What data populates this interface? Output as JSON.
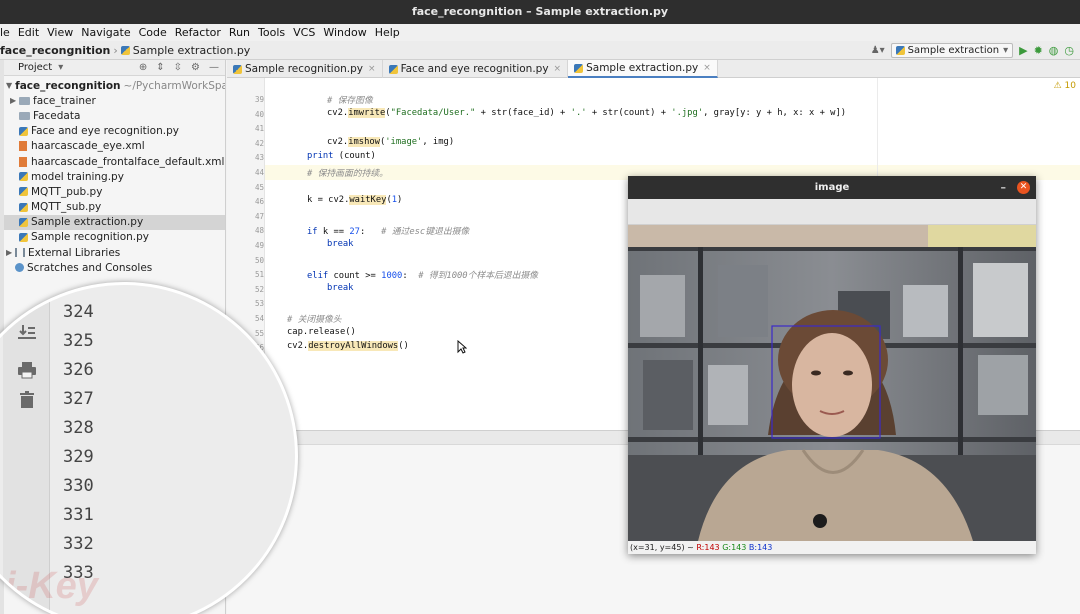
{
  "window": {
    "title": "face_recongnition – Sample extraction.py"
  },
  "menu": [
    "le",
    "Edit",
    "View",
    "Navigate",
    "Code",
    "Refactor",
    "Run",
    "Tools",
    "VCS",
    "Window",
    "Help"
  ],
  "nav": {
    "project": "face_recongnition",
    "file": "Sample extraction.py",
    "run_config": "Sample extraction"
  },
  "project_panel": {
    "title": "Project",
    "root": {
      "name": "face_recongnition",
      "path": "~/PycharmWorkSpace/"
    },
    "items": [
      {
        "label": "face_trainer",
        "type": "folder"
      },
      {
        "label": "Facedata",
        "type": "folder"
      },
      {
        "label": "Face and eye recognition.py",
        "type": "py"
      },
      {
        "label": "haarcascade_eye.xml",
        "type": "xml"
      },
      {
        "label": "haarcascade_frontalface_default.xml",
        "type": "xml"
      },
      {
        "label": "model training.py",
        "type": "py"
      },
      {
        "label": "MQTT_pub.py",
        "type": "py"
      },
      {
        "label": "MQTT_sub.py",
        "type": "py"
      },
      {
        "label": "Sample extraction.py",
        "type": "py",
        "selected": true
      },
      {
        "label": "Sample recognition.py",
        "type": "py"
      }
    ],
    "external": "External Libraries",
    "scratches": "Scratches and Consoles"
  },
  "tabs": [
    {
      "label": "Sample recognition.py",
      "active": false
    },
    {
      "label": "Face and eye recognition.py",
      "active": false
    },
    {
      "label": "Sample extraction.py",
      "active": true
    }
  ],
  "editor": {
    "warning": "⚠ 10",
    "line_numbers": [
      "39",
      "40",
      "41",
      "42",
      "43",
      "44",
      "45",
      "46",
      "47",
      "48",
      "49",
      "50",
      "51",
      "52",
      "53",
      "54",
      "55"
    ],
    "lines": [
      {
        "n": "39",
        "indent": 2,
        "parts": [
          {
            "t": "# 保存图像",
            "c": "cmt"
          }
        ]
      },
      {
        "n": "40",
        "indent": 2,
        "parts": [
          {
            "t": "cv2."
          },
          {
            "t": "imwrite",
            "c": "hl"
          },
          {
            "t": "("
          },
          {
            "t": "\"Facedata/User.\"",
            "c": "str"
          },
          {
            "t": " + str(face_id) + "
          },
          {
            "t": "'.'",
            "c": "str"
          },
          {
            "t": " + str(count) + "
          },
          {
            "t": "'.jpg'",
            "c": "str"
          },
          {
            "t": ", gray[y: y + h, x: x + w])"
          }
        ]
      },
      {
        "n": "41",
        "indent": 0,
        "parts": []
      },
      {
        "n": "42",
        "indent": 2,
        "parts": [
          {
            "t": "cv2."
          },
          {
            "t": "imshow",
            "c": "hl"
          },
          {
            "t": "("
          },
          {
            "t": "'image'",
            "c": "str"
          },
          {
            "t": ", img)"
          }
        ]
      },
      {
        "n": "43",
        "indent": 1,
        "parts": [
          {
            "t": "print",
            "c": "kw"
          },
          {
            "t": " (count)"
          }
        ]
      },
      {
        "n": "44",
        "indent": 1,
        "parts": [
          {
            "t": "# 保持画面的持续。",
            "c": "cmt"
          }
        ],
        "current": true
      },
      {
        "n": "45",
        "indent": 0,
        "parts": []
      },
      {
        "n": "46",
        "indent": 1,
        "parts": [
          {
            "t": "k = cv2."
          },
          {
            "t": "waitKey",
            "c": "hl"
          },
          {
            "t": "("
          },
          {
            "t": "1",
            "c": "num"
          },
          {
            "t": ")"
          }
        ]
      },
      {
        "n": "47",
        "indent": 0,
        "parts": []
      },
      {
        "n": "48",
        "indent": 1,
        "parts": [
          {
            "t": "if",
            "c": "kw"
          },
          {
            "t": " k == "
          },
          {
            "t": "27",
            "c": "num"
          },
          {
            "t": ":   "
          },
          {
            "t": "# 通过esc键退出摄像",
            "c": "cmt"
          }
        ]
      },
      {
        "n": "49",
        "indent": 2,
        "parts": [
          {
            "t": "break",
            "c": "kw"
          }
        ]
      },
      {
        "n": "50",
        "indent": 0,
        "parts": []
      },
      {
        "n": "51",
        "indent": 1,
        "parts": [
          {
            "t": "elif",
            "c": "kw"
          },
          {
            "t": " count >= "
          },
          {
            "t": "1000",
            "c": "num"
          },
          {
            "t": ":  "
          },
          {
            "t": "# 得到1000个样本后退出摄像",
            "c": "cmt"
          }
        ]
      },
      {
        "n": "52",
        "indent": 2,
        "parts": [
          {
            "t": "break",
            "c": "kw"
          }
        ]
      },
      {
        "n": "53",
        "indent": 0,
        "parts": []
      },
      {
        "n": "54",
        "indent": 0,
        "parts": [
          {
            "t": "# 关闭摄像头",
            "c": "cmt"
          }
        ]
      },
      {
        "n": "55",
        "indent": 0,
        "parts": [
          {
            "t": "cap.release()"
          }
        ]
      },
      {
        "n": "56",
        "indent": 0,
        "parts": [
          {
            "t": "cv2."
          },
          {
            "t": "destroyAllWindows",
            "c": "hl"
          },
          {
            "t": "()"
          }
        ]
      }
    ]
  },
  "magnifier": {
    "numbers": [
      "324",
      "325",
      "326",
      "327",
      "328",
      "329",
      "330",
      "331",
      "332",
      "333"
    ],
    "icons": [
      "scroll-to-end-icon",
      "print-icon",
      "trash-icon"
    ],
    "watermark": "i-Key"
  },
  "cv_window": {
    "title": "image",
    "status": {
      "coords": "(x=31, y=45) ~",
      "r": "R:143",
      "g": "G:143",
      "b": "B:143"
    }
  },
  "colors": {
    "accent": "#4a7fc1",
    "close": "#e95420",
    "face_box": "#3b2ac9"
  }
}
